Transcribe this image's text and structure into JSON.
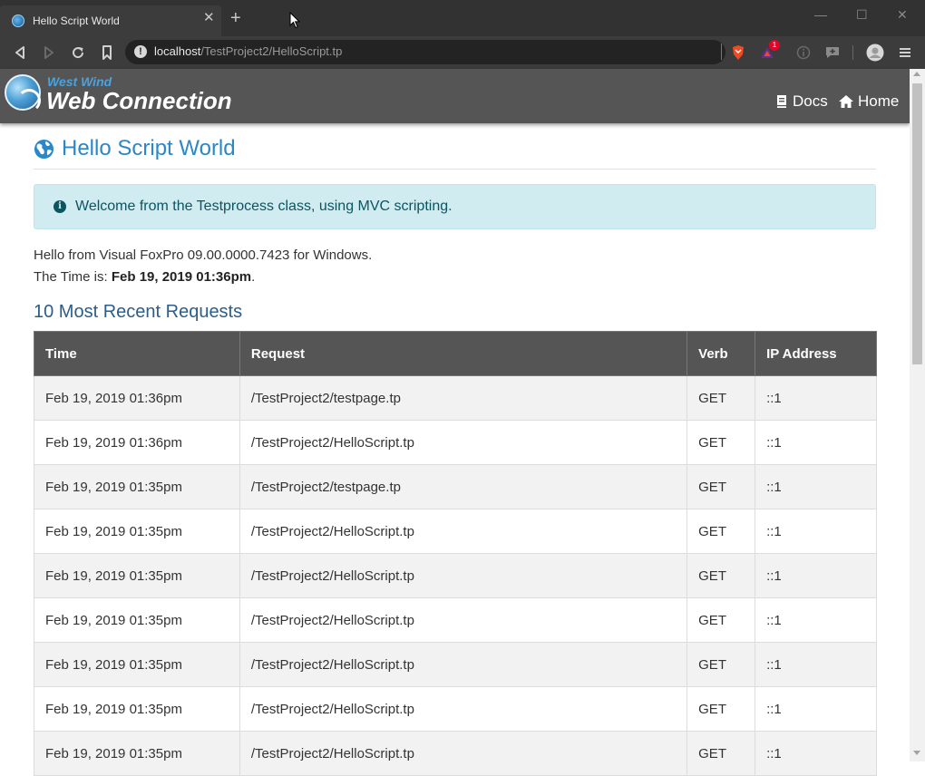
{
  "browser": {
    "tab_title": "Hello Script World",
    "url_host": "localhost",
    "url_path": "/TestProject2/HelloScript.tp",
    "brave_badge": "1"
  },
  "header": {
    "logo_small": "West Wind",
    "logo_big": "Web Connection",
    "nav": [
      {
        "label": "Docs",
        "icon": "book-icon"
      },
      {
        "label": "Home",
        "icon": "home-icon"
      }
    ]
  },
  "page": {
    "title": "Hello Script World",
    "alert": "Welcome from the Testprocess class, using MVC scripting.",
    "hello_line": "Hello from Visual FoxPro 09.00.0000.7423 for Windows.",
    "time_prefix": "The Time is: ",
    "time_value": "Feb 19, 2019 01:36pm",
    "time_suffix": ".",
    "section_title": "10 Most Recent Requests"
  },
  "table": {
    "columns": [
      "Time",
      "Request",
      "Verb",
      "IP Address"
    ],
    "rows": [
      [
        "Feb 19, 2019 01:36pm",
        "/TestProject2/testpage.tp",
        "GET",
        "::1"
      ],
      [
        "Feb 19, 2019 01:36pm",
        "/TestProject2/HelloScript.tp",
        "GET",
        "::1"
      ],
      [
        "Feb 19, 2019 01:35pm",
        "/TestProject2/testpage.tp",
        "GET",
        "::1"
      ],
      [
        "Feb 19, 2019 01:35pm",
        "/TestProject2/HelloScript.tp",
        "GET",
        "::1"
      ],
      [
        "Feb 19, 2019 01:35pm",
        "/TestProject2/HelloScript.tp",
        "GET",
        "::1"
      ],
      [
        "Feb 19, 2019 01:35pm",
        "/TestProject2/HelloScript.tp",
        "GET",
        "::1"
      ],
      [
        "Feb 19, 2019 01:35pm",
        "/TestProject2/HelloScript.tp",
        "GET",
        "::1"
      ],
      [
        "Feb 19, 2019 01:35pm",
        "/TestProject2/HelloScript.tp",
        "GET",
        "::1"
      ],
      [
        "Feb 19, 2019 01:35pm",
        "/TestProject2/HelloScript.tp",
        "GET",
        "::1"
      ]
    ]
  },
  "colors": {
    "accent": "#2b87c8",
    "header_bg": "#555555",
    "alert_bg": "#d1ecf1"
  }
}
